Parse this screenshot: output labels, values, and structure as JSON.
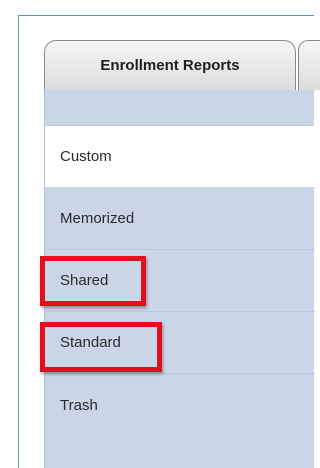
{
  "tabs": [
    {
      "label": "Enrollment Reports",
      "active": true
    },
    {
      "label": "",
      "active": false
    }
  ],
  "sidebar": {
    "items": [
      {
        "label": "Custom",
        "selected": true,
        "highlighted": false
      },
      {
        "label": "Memorized",
        "selected": false,
        "highlighted": false
      },
      {
        "label": "Shared",
        "selected": false,
        "highlighted": true
      },
      {
        "label": "Standard",
        "selected": false,
        "highlighted": true
      },
      {
        "label": "Trash",
        "selected": false,
        "highlighted": false
      }
    ]
  },
  "colors": {
    "frame_border": "#3aa9a5",
    "sidebar_bg": "#cbd5e8",
    "selected_bg": "#ffffff",
    "highlight_border": "#e0101c"
  }
}
